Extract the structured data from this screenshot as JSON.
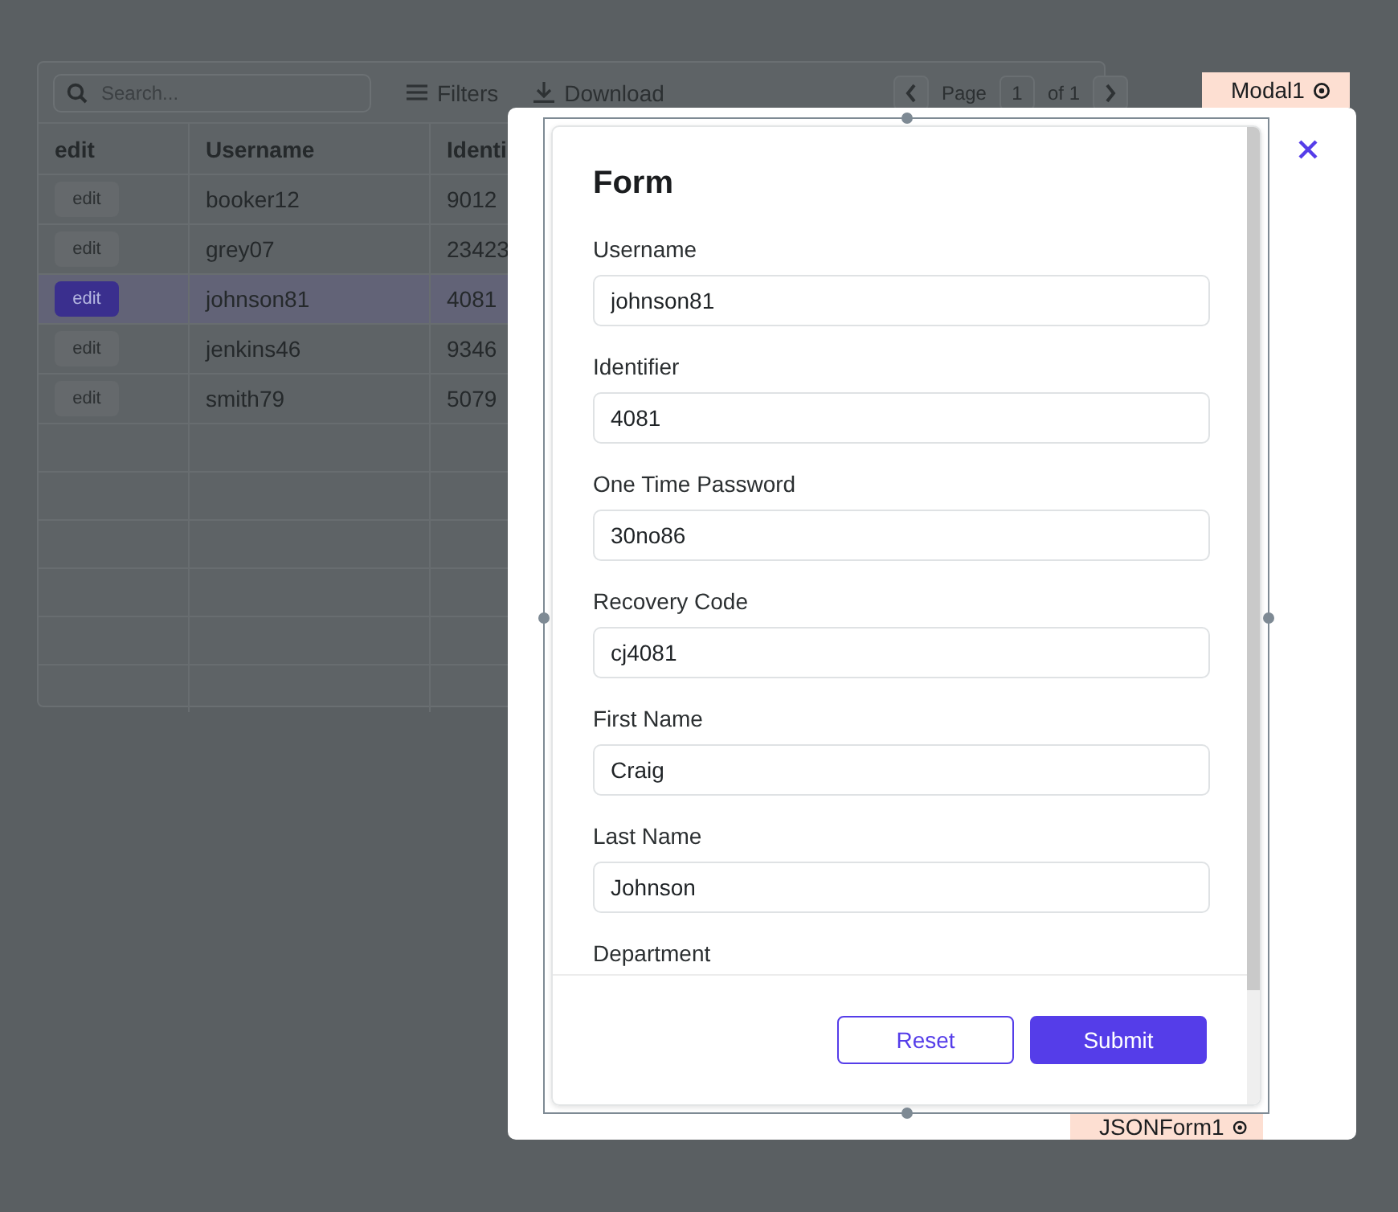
{
  "table": {
    "search": {
      "placeholder": "Search..."
    },
    "toolbar": [
      "Filters",
      "Download"
    ],
    "pager": {
      "label": "Page",
      "page": "1",
      "of": "of 1"
    },
    "columns": [
      "edit",
      "Username",
      "Identi"
    ],
    "rows": [
      {
        "action": "edit",
        "username": "booker12",
        "identifier": "9012",
        "selected": false
      },
      {
        "action": "edit",
        "username": "grey07",
        "identifier": "23423",
        "selected": false
      },
      {
        "action": "edit",
        "username": "johnson81",
        "identifier": "4081",
        "selected": true
      },
      {
        "action": "edit",
        "username": "jenkins46",
        "identifier": "9346",
        "selected": false
      },
      {
        "action": "edit",
        "username": "smith79",
        "identifier": "5079",
        "selected": false
      }
    ]
  },
  "modal": {
    "tag": "Modal1",
    "form_tag": "JSONForm1",
    "title": "Form",
    "fields": [
      {
        "label": "Username",
        "value": "johnson81"
      },
      {
        "label": "Identifier",
        "value": "4081"
      },
      {
        "label": "One Time Password",
        "value": "30no86"
      },
      {
        "label": "Recovery Code",
        "value": "cj4081"
      },
      {
        "label": "First Name",
        "value": "Craig"
      },
      {
        "label": "Last Name",
        "value": "Johnson"
      }
    ],
    "cut_label": "Department",
    "buttons": [
      {
        "label": "Reset",
        "kind": "outline"
      },
      {
        "label": "Submit",
        "kind": "primary"
      }
    ]
  }
}
